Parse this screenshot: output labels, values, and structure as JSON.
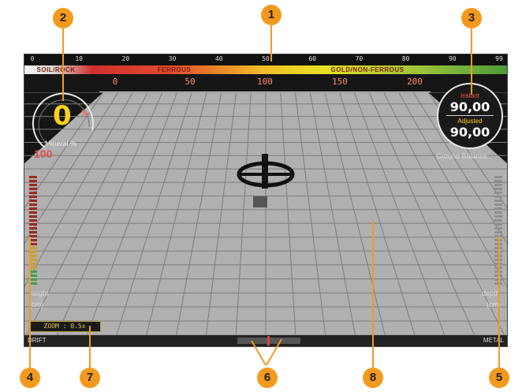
{
  "top_scale": {
    "ticks": [
      "0",
      "10",
      "20",
      "30",
      "40",
      "50",
      "60",
      "70",
      "80",
      "90",
      "99"
    ]
  },
  "target_bands": {
    "soil_rock": "SOIL/ROCK",
    "ferrous": "FERROUS",
    "gold": "GOLD/NON-FERROUS"
  },
  "depth_ruler": {
    "ticks": [
      "0",
      "50",
      "100",
      "150",
      "200"
    ]
  },
  "mineral_gauge": {
    "value": "0",
    "unit": "%",
    "label": "Mineral %",
    "max": "100"
  },
  "ground_balance": {
    "instant_label": "Instant",
    "instant_value": "90,00",
    "adjusted_label": "Adjusted",
    "adjusted_value": "90,00",
    "label": "Ground Balance"
  },
  "height_meter": {
    "label": "height",
    "unit": "(cm)"
  },
  "depth_meter": {
    "label": "depth",
    "unit": "(cm)"
  },
  "zoom": {
    "label": "ZOOM : 0.5x"
  },
  "bottom_bar": {
    "left": "DRIFT",
    "right": "METAL"
  },
  "callouts": [
    "1",
    "2",
    "3",
    "4",
    "5",
    "6",
    "7",
    "8"
  ],
  "colors": {
    "accent": "#f39a1e",
    "grid": "#bdbdbd",
    "mineral": "#ffd21a"
  }
}
